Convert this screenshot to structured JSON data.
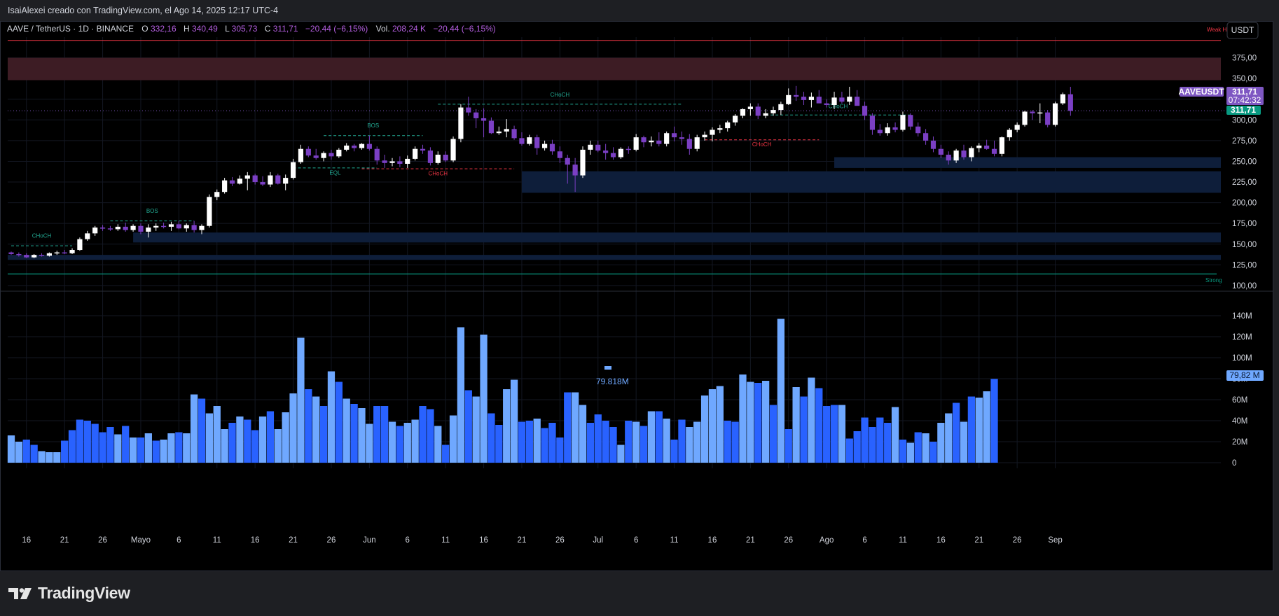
{
  "credit": "IsaiAlexei creado con TradingView.com, el Ago 14, 2025 12:17 UTC-4",
  "header": {
    "symbol": "AAVE / TetherUS · 1D · BINANCE",
    "o_label": "O",
    "o_value": "332,16",
    "h_label": "H",
    "h_value": "340,49",
    "l_label": "L",
    "l_value": "305,73",
    "c_label": "C",
    "c_value": "311,71",
    "change": "−20,44 (−6,15%)",
    "vol_label": "Vol.",
    "vol_value": "208,24 K",
    "vol_change": "−20,44 (−6,15%)"
  },
  "currency_button": "USDT",
  "price_tag": {
    "symbol": "AAVEUSDT",
    "price": "311,71",
    "countdown": "07:42:32",
    "price2": "311,71"
  },
  "volume_tag": "79,82 M",
  "volume_label": "79.818M",
  "labels": {
    "weak": "Weak H",
    "strong": "Strong",
    "choch": "CHoCH",
    "bos": "BOS",
    "eql": "EQL"
  },
  "brand": "TradingView",
  "colors": {
    "bull": "#ffffff",
    "bear": "#7b3fc4",
    "volume_bull": "#6fa8ff",
    "volume_bear": "#2962ff",
    "supply": "#3d1c24",
    "demand": "#0e1e3a",
    "weak_line": "#f23645",
    "strong_line": "#089981",
    "tag_purple": "#7e57c2",
    "tag_green": "#089981"
  },
  "chart_data": [
    {
      "type": "candlestick",
      "title": "AAVE / TetherUS · 1D · BINANCE",
      "y_ticks": [
        100,
        125,
        150,
        175,
        200,
        225,
        250,
        275,
        300,
        325,
        350,
        375
      ],
      "y_tick_labels": [
        "100,00",
        "125,00",
        "150,00",
        "175,00",
        "200,00",
        "225,00",
        "250,00",
        "275,00",
        "300,00",
        "325,00",
        "350,00",
        "375,00"
      ],
      "ylim": [
        94,
        400
      ],
      "x_tick_labels": [
        "16",
        "21",
        "26",
        "Mayo",
        "6",
        "11",
        "16",
        "21",
        "26",
        "Jun",
        "6",
        "11",
        "16",
        "21",
        "26",
        "Jul",
        "6",
        "11",
        "16",
        "21",
        "26",
        "Ago",
        "6",
        "11",
        "16",
        "21",
        "26",
        "Sep"
      ],
      "zones": {
        "supply": [
          [
            348,
            375
          ]
        ],
        "demand": [
          [
            242,
            255
          ],
          [
            212,
            238
          ],
          [
            152,
            164
          ],
          [
            131,
            137
          ]
        ],
        "weak_high": 396,
        "strong_low": 114
      },
      "candles": [
        [
          140,
          141,
          137,
          138
        ],
        [
          138,
          140,
          135,
          137
        ],
        [
          137,
          139,
          133,
          134
        ],
        [
          134,
          138,
          133,
          137
        ],
        [
          137,
          139,
          135,
          136
        ],
        [
          136,
          140,
          135,
          139
        ],
        [
          139,
          142,
          137,
          140
        ],
        [
          140,
          143,
          138,
          139
        ],
        [
          139,
          145,
          138,
          143
        ],
        [
          143,
          158,
          142,
          156
        ],
        [
          156,
          166,
          154,
          163
        ],
        [
          163,
          172,
          160,
          170
        ],
        [
          170,
          173,
          166,
          169
        ],
        [
          169,
          172,
          166,
          168
        ],
        [
          168,
          174,
          166,
          171
        ],
        [
          171,
          176,
          165,
          167
        ],
        [
          167,
          174,
          165,
          172
        ],
        [
          172,
          175,
          162,
          165
        ],
        [
          165,
          174,
          158,
          170
        ],
        [
          170,
          175,
          166,
          172
        ],
        [
          172,
          176,
          169,
          171
        ],
        [
          171,
          177,
          166,
          174
        ],
        [
          174,
          178,
          168,
          169
        ],
        [
          169,
          175,
          165,
          173
        ],
        [
          173,
          178,
          164,
          167
        ],
        [
          167,
          174,
          162,
          172
        ],
        [
          172,
          210,
          170,
          207
        ],
        [
          207,
          216,
          203,
          213
        ],
        [
          213,
          230,
          211,
          227
        ],
        [
          227,
          231,
          220,
          223
        ],
        [
          223,
          233,
          222,
          229
        ],
        [
          229,
          237,
          215,
          233
        ],
        [
          233,
          235,
          222,
          225
        ],
        [
          225,
          232,
          220,
          222
        ],
        [
          222,
          237,
          219,
          233
        ],
        [
          233,
          235,
          222,
          223
        ],
        [
          223,
          234,
          215,
          230
        ],
        [
          230,
          253,
          228,
          249
        ],
        [
          249,
          270,
          247,
          265
        ],
        [
          265,
          268,
          255,
          257
        ],
        [
          257,
          265,
          252,
          254
        ],
        [
          254,
          262,
          250,
          260
        ],
        [
          260,
          264,
          252,
          256
        ],
        [
          256,
          266,
          254,
          264
        ],
        [
          264,
          272,
          262,
          269
        ],
        [
          269,
          271,
          262,
          266
        ],
        [
          266,
          272,
          264,
          271
        ],
        [
          271,
          281,
          263,
          265
        ],
        [
          265,
          268,
          246,
          251
        ],
        [
          251,
          258,
          242,
          248
        ],
        [
          248,
          254,
          244,
          250
        ],
        [
          250,
          256,
          243,
          247
        ],
        [
          247,
          257,
          242,
          253
        ],
        [
          253,
          268,
          251,
          265
        ],
        [
          265,
          270,
          259,
          263
        ],
        [
          263,
          267,
          245,
          248
        ],
        [
          248,
          262,
          246,
          258
        ],
        [
          258,
          262,
          249,
          251
        ],
        [
          251,
          280,
          249,
          277
        ],
        [
          277,
          319,
          273,
          315
        ],
        [
          315,
          328,
          305,
          309
        ],
        [
          309,
          313,
          290,
          302
        ],
        [
          302,
          314,
          279,
          299
        ],
        [
          299,
          303,
          283,
          284
        ],
        [
          284,
          292,
          282,
          286
        ],
        [
          286,
          301,
          279,
          289
        ],
        [
          289,
          293,
          276,
          278
        ],
        [
          278,
          285,
          269,
          271
        ],
        [
          271,
          282,
          269,
          279
        ],
        [
          279,
          282,
          258,
          266
        ],
        [
          266,
          275,
          263,
          271
        ],
        [
          271,
          276,
          258,
          262
        ],
        [
          262,
          268,
          248,
          254
        ],
        [
          254,
          258,
          223,
          246
        ],
        [
          246,
          254,
          213,
          233
        ],
        [
          233,
          268,
          230,
          264
        ],
        [
          264,
          275,
          258,
          270
        ],
        [
          270,
          275,
          261,
          263
        ],
        [
          263,
          271,
          252,
          260
        ],
        [
          260,
          267,
          252,
          255
        ],
        [
          255,
          267,
          253,
          265
        ],
        [
          265,
          268,
          259,
          264
        ],
        [
          264,
          283,
          262,
          279
        ],
        [
          279,
          281,
          267,
          273
        ],
        [
          273,
          280,
          268,
          275
        ],
        [
          275,
          285,
          268,
          271
        ],
        [
          271,
          286,
          268,
          284
        ],
        [
          284,
          292,
          274,
          279
        ],
        [
          279,
          286,
          270,
          277
        ],
        [
          277,
          283,
          258,
          265
        ],
        [
          265,
          282,
          262,
          279
        ],
        [
          279,
          286,
          275,
          282
        ],
        [
          282,
          291,
          274,
          288
        ],
        [
          288,
          294,
          284,
          290
        ],
        [
          290,
          299,
          286,
          297
        ],
        [
          297,
          307,
          293,
          305
        ],
        [
          305,
          314,
          302,
          313
        ],
        [
          313,
          320,
          305,
          316
        ],
        [
          316,
          320,
          301,
          305
        ],
        [
          305,
          313,
          302,
          308
        ],
        [
          308,
          316,
          305,
          312
        ],
        [
          312,
          322,
          306,
          319
        ],
        [
          319,
          338,
          318,
          330
        ],
        [
          330,
          341,
          323,
          328
        ],
        [
          328,
          334,
          318,
          324
        ],
        [
          324,
          333,
          315,
          328
        ],
        [
          328,
          336,
          321,
          320
        ],
        [
          320,
          325,
          315,
          318
        ],
        [
          318,
          334,
          313,
          327
        ],
        [
          327,
          334,
          320,
          322
        ],
        [
          322,
          340,
          318,
          328
        ],
        [
          328,
          336,
          319,
          317
        ],
        [
          317,
          322,
          300,
          305
        ],
        [
          305,
          308,
          282,
          288
        ],
        [
          288,
          295,
          281,
          284
        ],
        [
          284,
          296,
          281,
          291
        ],
        [
          291,
          297,
          285,
          288
        ],
        [
          288,
          310,
          286,
          306
        ],
        [
          306,
          308,
          288,
          292
        ],
        [
          292,
          297,
          280,
          284
        ],
        [
          284,
          289,
          270,
          275
        ],
        [
          275,
          280,
          261,
          265
        ],
        [
          265,
          270,
          254,
          258
        ],
        [
          258,
          262,
          246,
          251
        ],
        [
          251,
          265,
          248,
          263
        ],
        [
          263,
          270,
          252,
          255
        ],
        [
          255,
          268,
          250,
          266
        ],
        [
          266,
          272,
          261,
          269
        ],
        [
          269,
          276,
          264,
          265
        ],
        [
          265,
          275,
          256,
          259
        ],
        [
          259,
          280,
          256,
          279
        ],
        [
          279,
          290,
          275,
          288
        ],
        [
          288,
          297,
          285,
          294
        ],
        [
          294,
          311,
          292,
          310
        ],
        [
          310,
          312,
          300,
          308
        ],
        [
          308,
          320,
          296,
          309
        ],
        [
          309,
          312,
          291,
          294
        ],
        [
          294,
          322,
          292,
          320
        ],
        [
          320,
          333,
          318,
          331
        ],
        [
          331,
          340,
          305,
          311
        ]
      ]
    },
    {
      "type": "bar",
      "title": "Volume",
      "y_ticks": [
        0,
        20,
        40,
        60,
        80,
        100,
        120,
        140
      ],
      "y_tick_labels": [
        "0",
        "20M",
        "40M",
        "60M",
        "80M",
        "100M",
        "120M",
        "140M"
      ],
      "ylim": [
        0,
        152
      ],
      "values": [
        26,
        20,
        22,
        17,
        11,
        10,
        10,
        21,
        31,
        41,
        40,
        37,
        29,
        34,
        27,
        35,
        24,
        24,
        28,
        21,
        22,
        28,
        29,
        28,
        65,
        61,
        47,
        54,
        32,
        38,
        44,
        41,
        31,
        44,
        49,
        32,
        48,
        66,
        119,
        70,
        63,
        54,
        87,
        77,
        61,
        56,
        52,
        37,
        54,
        54,
        39,
        35,
        38,
        41,
        54,
        51,
        35,
        17,
        45,
        129,
        69,
        63,
        122,
        47,
        36,
        70,
        79,
        39,
        40,
        42,
        33,
        38,
        24,
        67,
        67,
        55,
        38,
        46,
        40,
        34,
        17,
        40,
        39,
        35,
        49,
        49,
        42,
        22,
        41,
        34,
        39,
        64,
        70,
        73,
        40,
        39,
        84,
        77,
        76,
        78,
        55,
        137,
        32,
        72,
        63,
        81,
        71,
        54,
        55,
        55,
        23,
        30,
        43,
        34,
        43,
        38,
        53,
        22,
        19,
        29,
        28,
        20,
        38,
        47,
        57,
        39,
        63,
        62,
        68,
        79.82
      ],
      "bull": [
        true,
        true,
        false,
        false,
        true,
        true,
        true,
        false,
        false,
        false,
        false,
        false,
        false,
        false,
        true,
        false,
        true,
        false,
        true,
        false,
        true,
        true,
        false,
        true,
        true,
        false,
        true,
        true,
        true,
        false,
        true,
        false,
        false,
        true,
        false,
        true,
        true,
        true,
        true,
        false,
        true,
        false,
        true,
        false,
        true,
        false,
        true,
        true,
        false,
        false,
        true,
        false,
        true,
        true,
        false,
        false,
        true,
        false,
        true,
        true,
        false,
        true,
        true,
        false,
        false,
        true,
        true,
        false,
        false,
        true,
        false,
        false,
        false,
        false,
        true,
        true,
        false,
        false,
        false,
        false,
        true,
        false,
        true,
        false,
        true,
        false,
        true,
        false,
        false,
        true,
        true,
        true,
        true,
        true,
        false,
        false,
        true,
        true,
        false,
        true,
        false,
        true,
        false,
        true,
        false,
        true,
        false,
        false,
        false,
        true,
        false,
        false,
        false,
        false,
        false,
        false,
        true,
        false,
        true,
        false,
        true,
        false,
        true,
        true,
        false,
        true,
        false,
        true,
        true,
        false
      ],
      "last_value_label": "79.818M"
    }
  ]
}
